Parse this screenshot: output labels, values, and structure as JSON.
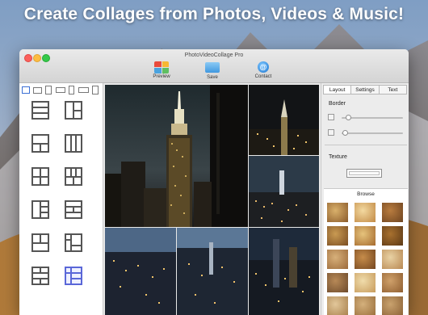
{
  "headline": "Create Collages from Photos, Videos & Music!",
  "window": {
    "title": "PhotoVideoCollage Pro",
    "toolbar": {
      "preview_label": "Preview",
      "save_label": "Save",
      "contact_label": "Contact"
    }
  },
  "inspector": {
    "tabs": [
      "Layout",
      "Settings",
      "Text"
    ],
    "active_tab": "Layout",
    "border_label": "Border",
    "border_slider_level": 0.1,
    "shadow_slider_level": 0.05,
    "texture_label": "Texture",
    "browse_label": "Browse"
  },
  "layouts": {
    "selected_index": 11
  },
  "colors": {
    "accent": "#5a67d8",
    "window_bg": "#ececec"
  }
}
